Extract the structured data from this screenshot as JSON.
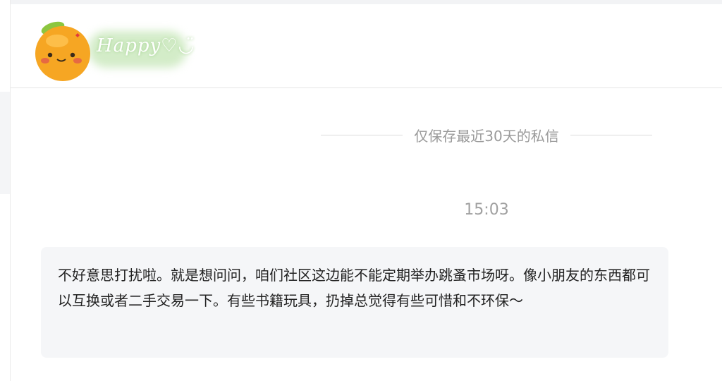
{
  "header": {
    "avatar_text": "Happy♡◡̈"
  },
  "chat": {
    "retention_notice": "仅保存最近30天的私信",
    "timestamp": "15:03",
    "messages": [
      {
        "text": "不好意思打扰啦。就是想问问，咱们社区这边能不能定期举办跳蚤市场呀。像小朋友的东西都可以互换或者二手交易一下。有些书籍玩具，扔掉总觉得有些可惜和不环保～"
      }
    ]
  },
  "colors": {
    "bubble_background": "#f5f6f8",
    "notice_text": "#9a9a9a",
    "message_text": "#222222",
    "orange": "#f6a623",
    "leaf": "#8cc63f"
  }
}
